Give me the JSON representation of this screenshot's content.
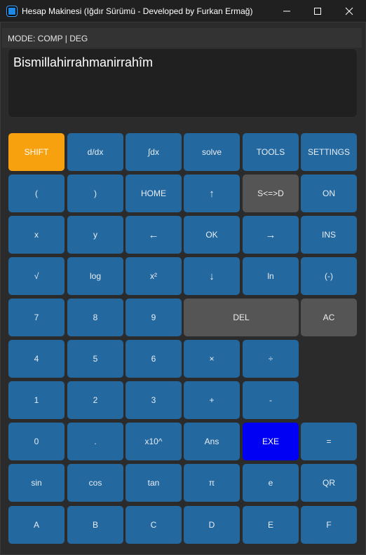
{
  "window": {
    "title": "Hesap Makinesi (Iğdır Sürümü - Developed by Furkan Ermağ)"
  },
  "mode": "MODE: COMP | DEG",
  "display": {
    "text": "Bismillahirrahmanirrahîm"
  },
  "colors": {
    "button": "#2468a0",
    "shift": "#f7a10e",
    "gray": "#555555",
    "exe": "#0000f5"
  },
  "keys": [
    {
      "label": "SHIFT",
      "name": "shift-button",
      "style": "orange"
    },
    {
      "label": "d/dx",
      "name": "derivative-button"
    },
    {
      "label": "∫dx",
      "name": "integral-button"
    },
    {
      "label": "solve",
      "name": "solve-button"
    },
    {
      "label": "TOOLS",
      "name": "tools-button"
    },
    {
      "label": "SETTINGS",
      "name": "settings-button"
    },
    {
      "label": "(",
      "name": "open-paren-button"
    },
    {
      "label": ")",
      "name": "close-paren-button"
    },
    {
      "label": "HOME",
      "name": "home-button"
    },
    {
      "label": "↑",
      "name": "up-arrow-button",
      "style": "arrow"
    },
    {
      "label": "S<=>D",
      "name": "s-d-toggle-button",
      "style": "gray"
    },
    {
      "label": "ON",
      "name": "on-button"
    },
    {
      "label": "x",
      "name": "var-x-button"
    },
    {
      "label": "y",
      "name": "var-y-button"
    },
    {
      "label": "←",
      "name": "left-arrow-button",
      "style": "arrow"
    },
    {
      "label": "OK",
      "name": "ok-button"
    },
    {
      "label": "→",
      "name": "right-arrow-button",
      "style": "arrow"
    },
    {
      "label": "INS",
      "name": "insert-button"
    },
    {
      "label": "√",
      "name": "sqrt-button"
    },
    {
      "label": "log",
      "name": "log-button"
    },
    {
      "label": "x²",
      "name": "square-button"
    },
    {
      "label": "↓",
      "name": "down-arrow-button",
      "style": "arrow"
    },
    {
      "label": "ln",
      "name": "ln-button"
    },
    {
      "label": "(-)",
      "name": "negate-button"
    },
    {
      "label": "7",
      "name": "digit-7-button"
    },
    {
      "label": "8",
      "name": "digit-8-button"
    },
    {
      "label": "9",
      "name": "digit-9-button"
    },
    {
      "label": "DEL",
      "name": "delete-button",
      "style": "gray"
    },
    {
      "label": "AC",
      "name": "all-clear-button",
      "style": "gray"
    },
    {
      "label": "4",
      "name": "digit-4-button"
    },
    {
      "label": "5",
      "name": "digit-5-button"
    },
    {
      "label": "6",
      "name": "digit-6-button"
    },
    {
      "label": "×",
      "name": "multiply-button"
    },
    {
      "label": "÷",
      "name": "divide-button"
    },
    {
      "label": "1",
      "name": "digit-1-button"
    },
    {
      "label": "2",
      "name": "digit-2-button"
    },
    {
      "label": "3",
      "name": "digit-3-button"
    },
    {
      "label": "+",
      "name": "plus-button"
    },
    {
      "label": "-",
      "name": "minus-button"
    },
    {
      "label": "0",
      "name": "digit-0-button"
    },
    {
      "label": ".",
      "name": "decimal-point-button"
    },
    {
      "label": "x10^",
      "name": "times-ten-power-button"
    },
    {
      "label": "Ans",
      "name": "ans-button"
    },
    {
      "label": "EXE",
      "name": "exe-button",
      "style": "exe"
    },
    {
      "label": "=",
      "name": "equals-button"
    },
    {
      "label": "sin",
      "name": "sin-button"
    },
    {
      "label": "cos",
      "name": "cos-button"
    },
    {
      "label": "tan",
      "name": "tan-button"
    },
    {
      "label": "π",
      "name": "pi-button"
    },
    {
      "label": "e",
      "name": "euler-e-button"
    },
    {
      "label": "QR",
      "name": "qr-button"
    },
    {
      "label": "A",
      "name": "letter-a-button"
    },
    {
      "label": "B",
      "name": "letter-b-button"
    },
    {
      "label": "C",
      "name": "letter-c-button"
    },
    {
      "label": "D",
      "name": "letter-d-button"
    },
    {
      "label": "E",
      "name": "letter-e-button"
    },
    {
      "label": "F",
      "name": "letter-f-button"
    }
  ]
}
